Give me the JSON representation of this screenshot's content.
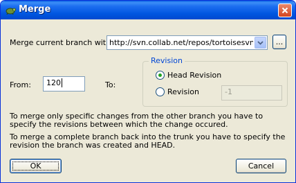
{
  "window": {
    "title": "Merge"
  },
  "merge_with": {
    "label": "Merge current branch with:",
    "value": "http://svn.collab.net/repos/tortoisesvn/trunk",
    "browse_label": "..."
  },
  "from": {
    "label": "From:",
    "value": "120"
  },
  "to": {
    "label": "To:"
  },
  "revision_group": {
    "title": "Revision",
    "head_label": "Head Revision",
    "revision_label": "Revision",
    "revision_placeholder": "-1",
    "selected": "head"
  },
  "help": {
    "line1": "To merge only specific changes from the other branch you have to specify the revisions between which the change occured.",
    "line2": "To merge a complete branch back into the trunk you have to specify the revision the branch was created and HEAD."
  },
  "buttons": {
    "ok": "OK",
    "cancel": "Cancel"
  },
  "icons": {
    "app": "tortoisesvn-icon",
    "close": "close-icon",
    "dropdown": "chevron-down-icon"
  }
}
